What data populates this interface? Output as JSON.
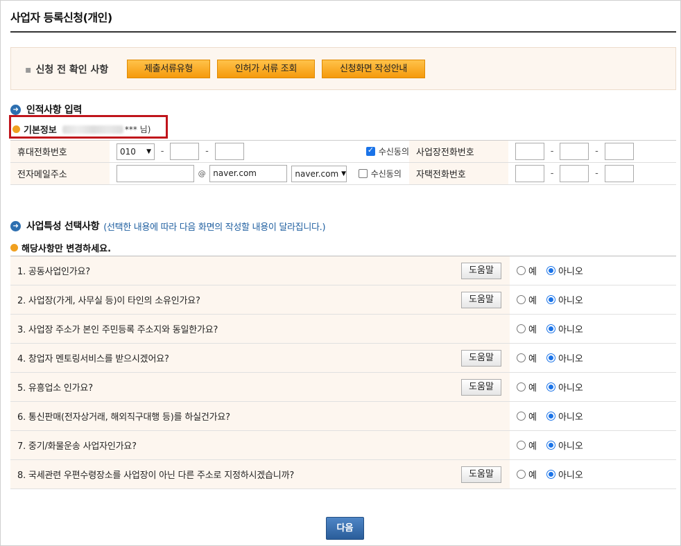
{
  "page": {
    "title": "사업자 등록신청(개인)"
  },
  "notice": {
    "label": "신청 전 확인 사항",
    "buttons": [
      "제출서류유형",
      "인허가 서류 조회",
      "신청화면 작성안내"
    ]
  },
  "personal_section": {
    "title": "인적사항 입력"
  },
  "basic_info": {
    "label": "기본정보",
    "name_suffix": "*** 님)"
  },
  "contact": {
    "mobile_label": "휴대전화번호",
    "mobile_prefix": "010",
    "consent_label": "수신동의",
    "business_phone_label": "사업장전화번호",
    "email_label": "전자메일주소",
    "email_at": "@",
    "email_domain_value": "naver.com",
    "email_domain_select": "naver.com",
    "home_phone_label": "자택전화번호",
    "dash": "-"
  },
  "business_section": {
    "title": "사업특성 선택사항",
    "subtitle": "(선택한 내용에 따라 다음 화면의 작성할 내용이 달라집니다.)",
    "note": "해당사항만 변경하세요."
  },
  "questions": [
    {
      "text": "1. 공동사업인가요?",
      "help": "도움말"
    },
    {
      "text": "2. 사업장(가게, 사무실 등)이 타인의 소유인가요?",
      "help": "도움말"
    },
    {
      "text": "3. 사업장 주소가 본인 주민등록 주소지와 동일한가요?",
      "help": ""
    },
    {
      "text": "4. 창업자 멘토링서비스를 받으시겠어요?",
      "help": "도움말"
    },
    {
      "text": "5. 유흥업소 인가요?",
      "help": "도움말"
    },
    {
      "text": "6. 통신판매(전자상거래, 해외직구대행 등)를 하실건가요?",
      "help": ""
    },
    {
      "text": "7. 중기/화물운송 사업자인가요?",
      "help": ""
    },
    {
      "text": "8. 국세관련 우편수령장소를 사업장이 아닌 다른 주소로 지정하시겠습니까?",
      "help": "도움말"
    }
  ],
  "answers": {
    "yes": "예",
    "no": "아니오"
  },
  "next_button": "다음",
  "colors": {
    "accent_blue": "#2a5d9a",
    "highlight_red": "#c0141b",
    "orange": "#f59a0c"
  }
}
